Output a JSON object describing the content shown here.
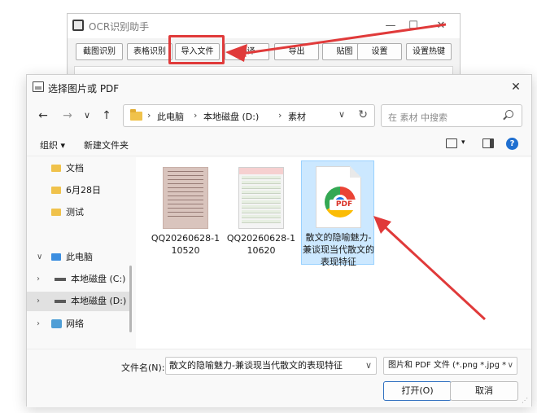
{
  "bg_app": {
    "title": "OCR识别助手",
    "minimize": "—",
    "maximize": "☐",
    "close": "✕",
    "toolbar": [
      "截图识别",
      "表格识别",
      "导入文件",
      "翻译",
      "导出",
      "贴图",
      "设置",
      "设置热键"
    ]
  },
  "dialog": {
    "title": "选择图片或 PDF",
    "close": "✕",
    "nav": {
      "back": "←",
      "forward": "→",
      "recent": "∨",
      "up": "↑"
    },
    "breadcrumb": [
      "此电脑",
      "本地磁盘 (D:)",
      "素材"
    ],
    "breadcrumb_sep": "›",
    "address_dropdown": "∨",
    "refresh": "↻",
    "search_placeholder": "在 素材 中搜索",
    "organize": "组织 ▾",
    "new_folder": "新建文件夹",
    "view_dropdown": "▾",
    "help": "?",
    "nav_items": [
      {
        "label": "文档"
      },
      {
        "label": "6月28日"
      },
      {
        "label": "测试"
      },
      {
        "label": "此电脑",
        "chevron": "∨"
      },
      {
        "label": "本地磁盘 (C:)",
        "chevron": "›"
      },
      {
        "label": "本地磁盘 (D:)",
        "chevron": "›"
      },
      {
        "label": "网络",
        "chevron": "›"
      }
    ],
    "files": [
      {
        "name": "QQ20260628-110520"
      },
      {
        "name": "QQ20260628-110620"
      },
      {
        "name": "散文的隐喻魅力-兼谈现当代散文的表现特征",
        "badge": "PDF"
      }
    ],
    "filename_label": "文件名(N):",
    "filename_value": "散文的隐喻魅力-兼谈现当代散文的表现特征",
    "filetype_value": "图片和 PDF 文件 (*.png *.jpg *",
    "dropdown": "∨",
    "open_button": "打开(O)",
    "cancel_button": "取消"
  },
  "colors": {
    "annotation": "#e03a3a",
    "accent": "#2f6fbf",
    "selection": "#cce8ff"
  }
}
